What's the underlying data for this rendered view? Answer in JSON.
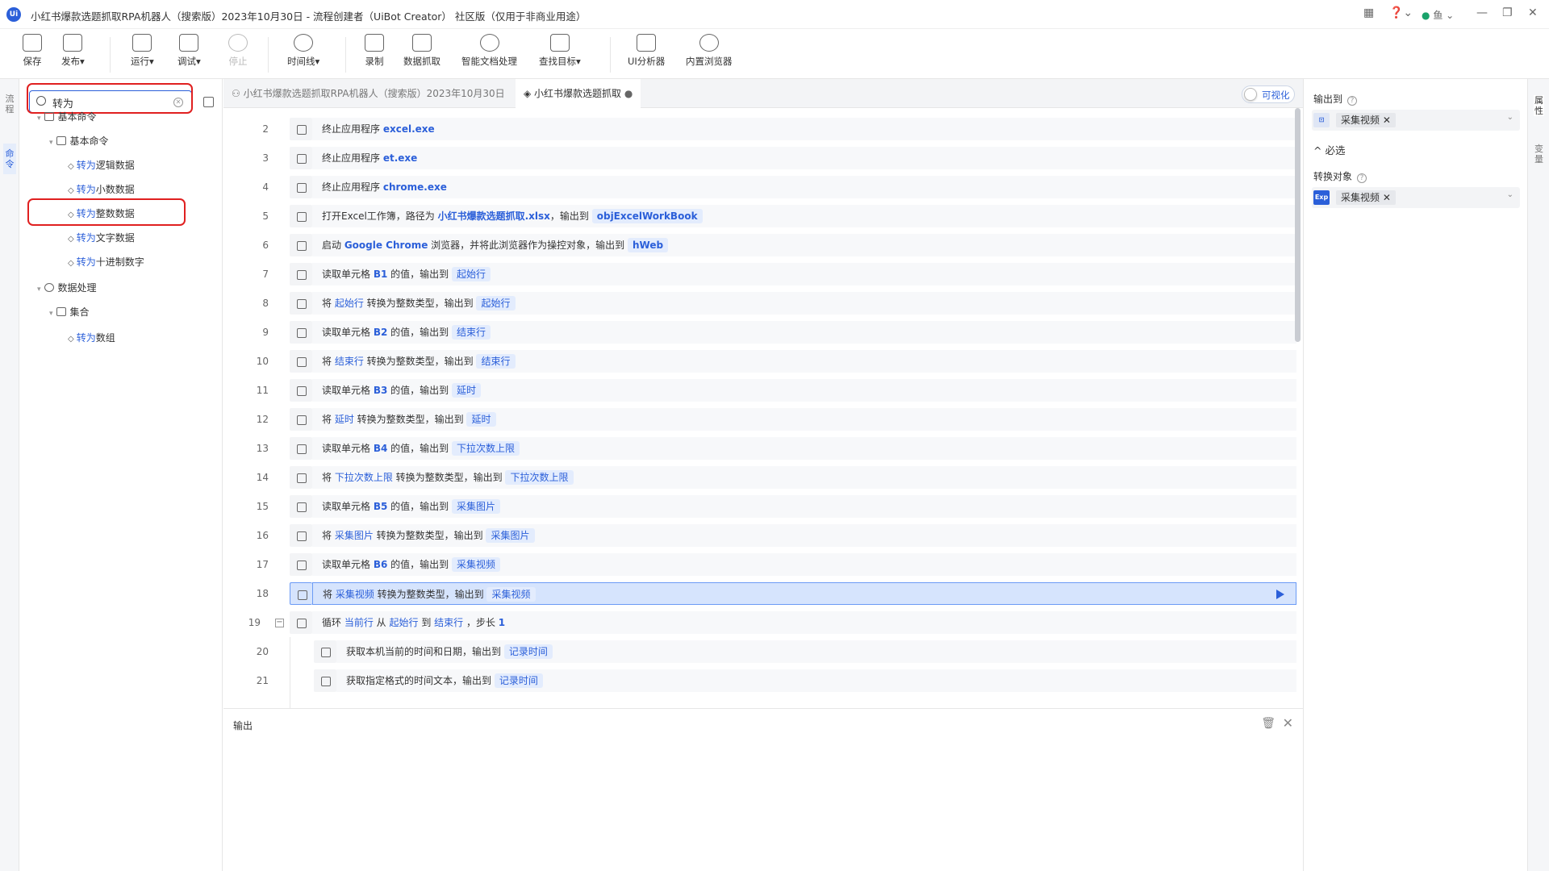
{
  "window": {
    "title": "小红书爆款选题抓取RPA机器人（搜索版）2023年10月30日 - 流程创建者（UiBot Creator） 社区版（仅用于非商业用途）",
    "user": "鱼",
    "minimize": "—",
    "restore": "❐",
    "close": "✕"
  },
  "toolbar": {
    "save": "保存",
    "publish": "发布",
    "run": "运行",
    "debug": "调试",
    "stop": "停止",
    "timeline": "时间线",
    "record": "录制",
    "data_capture": "数据抓取",
    "smart_doc": "智能文档处理",
    "find_target": "查找目标",
    "ui_analyzer": "UI分析器",
    "builtin_browser": "内置浏览器"
  },
  "left_tabs": [
    "流程",
    "命令"
  ],
  "search": {
    "value": "转为"
  },
  "tree": {
    "basic_commands": "基本命令",
    "basic_commands_sub": "基本命令",
    "items": [
      {
        "hl": "转为",
        "rest": "逻辑数据"
      },
      {
        "hl": "转为",
        "rest": "小数数据"
      },
      {
        "hl": "转为",
        "rest": "整数数据"
      },
      {
        "hl": "转为",
        "rest": "文字数据"
      },
      {
        "hl": "转为",
        "rest": "十进制数字"
      }
    ],
    "data_processing": "数据处理",
    "collection": "集合",
    "array_item": {
      "hl": "转为",
      "rest": "数组"
    }
  },
  "editor_tabs": {
    "tab1": "小红书爆款选题抓取RPA机器人（搜索版）2023年10月30日",
    "tab2": "小红书爆款选题抓取",
    "visual_toggle": "可视化"
  },
  "code": {
    "l2": {
      "num": "2",
      "pre": "终止应用程序 ",
      "v1": "excel.exe"
    },
    "l3": {
      "num": "3",
      "pre": "终止应用程序 ",
      "v1": "et.exe"
    },
    "l4": {
      "num": "4",
      "pre": "终止应用程序 ",
      "v1": "chrome.exe"
    },
    "l5": {
      "num": "5",
      "pre": "打开Excel工作簿，路径为 ",
      "v1": "小红书爆款选题抓取.xlsx",
      "mid": "，输出到 ",
      "out": "objExcelWorkBook"
    },
    "l6": {
      "num": "6",
      "pre": "启动 ",
      "v1": "Google Chrome",
      "mid": " 浏览器，并将此浏览器作为操控对象，输出到 ",
      "out": "hWeb"
    },
    "l7": {
      "num": "7",
      "pre": "读取单元格 ",
      "v1": "B1",
      "mid": " 的值，输出到 ",
      "out": "起始行"
    },
    "l8": {
      "num": "8",
      "pre": "将 ",
      "v1": "起始行",
      "mid": " 转换为整数类型，输出到 ",
      "out": "起始行"
    },
    "l9": {
      "num": "9",
      "pre": "读取单元格 ",
      "v1": "B2",
      "mid": " 的值，输出到 ",
      "out": "结束行"
    },
    "l10": {
      "num": "10",
      "pre": "将 ",
      "v1": "结束行",
      "mid": " 转换为整数类型，输出到 ",
      "out": "结束行"
    },
    "l11": {
      "num": "11",
      "pre": "读取单元格 ",
      "v1": "B3",
      "mid": " 的值，输出到 ",
      "out": "延时"
    },
    "l12": {
      "num": "12",
      "pre": "将 ",
      "v1": "延时",
      "mid": " 转换为整数类型，输出到 ",
      "out": "延时"
    },
    "l13": {
      "num": "13",
      "pre": "读取单元格 ",
      "v1": "B4",
      "mid": " 的值，输出到 ",
      "out": "下拉次数上限"
    },
    "l14": {
      "num": "14",
      "pre": "将 ",
      "v1": "下拉次数上限",
      "mid": " 转换为整数类型，输出到 ",
      "out": "下拉次数上限"
    },
    "l15": {
      "num": "15",
      "pre": "读取单元格 ",
      "v1": "B5",
      "mid": " 的值，输出到 ",
      "out": "采集图片"
    },
    "l16": {
      "num": "16",
      "pre": "将 ",
      "v1": "采集图片",
      "mid": " 转换为整数类型，输出到 ",
      "out": "采集图片"
    },
    "l17": {
      "num": "17",
      "pre": "读取单元格 ",
      "v1": "B6",
      "mid": " 的值，输出到 ",
      "out": "采集视频"
    },
    "l18": {
      "num": "18",
      "pre": "将 ",
      "v1": "采集视频",
      "mid": " 转换为整数类型，输出到 ",
      "out": "采集视频"
    },
    "l19": {
      "num": "19",
      "pre": "循环 ",
      "v1": "当前行",
      "m1": " 从 ",
      "v2": "起始行",
      "m2": " 到 ",
      "v3": "结束行",
      "m3": " ，步长 ",
      "v4": "1"
    },
    "l20": {
      "num": "20",
      "pre": "获取本机当前的时间和日期，输出到 ",
      "out": "记录时间"
    },
    "l21": {
      "num": "21",
      "pre": "获取指定格式的时间文本，输出到 ",
      "out": "记录时间"
    }
  },
  "output_panel": {
    "title": "输出"
  },
  "props": {
    "output_to": "输出到",
    "output_value": "采集视频",
    "required": "必选",
    "convert_object": "转换对象",
    "convert_value": "采集视频",
    "exp_icon": "Exp"
  },
  "right_tabs": [
    "属性",
    "变量"
  ]
}
